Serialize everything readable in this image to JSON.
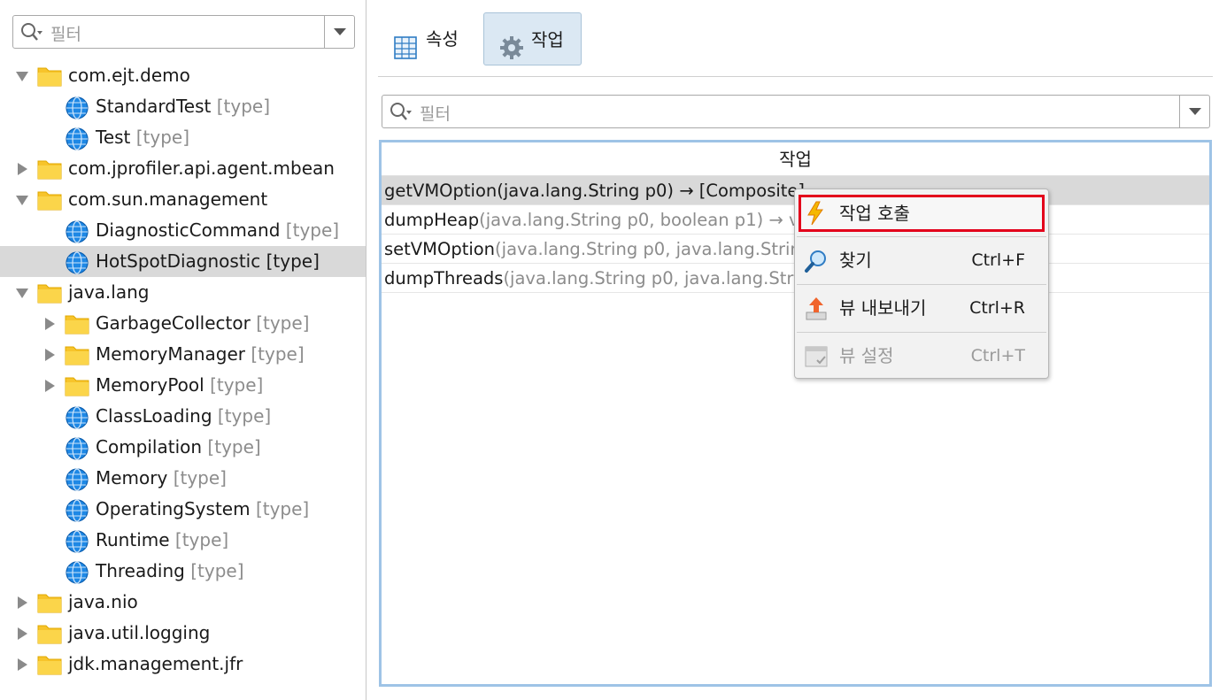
{
  "left_panel": {
    "filter_placeholder": "필터",
    "tree": [
      {
        "label": "com.ejt.demo",
        "kind": "folder",
        "level": 0,
        "arrow": "open"
      },
      {
        "label": "StandardTest",
        "suffix": "[type]",
        "kind": "globe",
        "level": 1,
        "arrow": "none"
      },
      {
        "label": "Test",
        "suffix": "[type]",
        "kind": "globe",
        "level": 1,
        "arrow": "none"
      },
      {
        "label": "com.jprofiler.api.agent.mbean",
        "kind": "folder",
        "level": 0,
        "arrow": "closed"
      },
      {
        "label": "com.sun.management",
        "kind": "folder",
        "level": 0,
        "arrow": "open"
      },
      {
        "label": "DiagnosticCommand",
        "suffix": "[type]",
        "kind": "globe",
        "level": 1,
        "arrow": "none"
      },
      {
        "label": "HotSpotDiagnostic",
        "suffix": "[type]",
        "kind": "globe",
        "level": 1,
        "arrow": "none",
        "selected": true
      },
      {
        "label": "java.lang",
        "kind": "folder",
        "level": 0,
        "arrow": "open"
      },
      {
        "label": "GarbageCollector",
        "suffix": "[type]",
        "kind": "folder",
        "level": 1,
        "arrow": "closed"
      },
      {
        "label": "MemoryManager",
        "suffix": "[type]",
        "kind": "folder",
        "level": 1,
        "arrow": "closed"
      },
      {
        "label": "MemoryPool",
        "suffix": "[type]",
        "kind": "folder",
        "level": 1,
        "arrow": "closed"
      },
      {
        "label": "ClassLoading",
        "suffix": "[type]",
        "kind": "globe",
        "level": 1,
        "arrow": "none"
      },
      {
        "label": "Compilation",
        "suffix": "[type]",
        "kind": "globe",
        "level": 1,
        "arrow": "none"
      },
      {
        "label": "Memory",
        "suffix": "[type]",
        "kind": "globe",
        "level": 1,
        "arrow": "none"
      },
      {
        "label": "OperatingSystem",
        "suffix": "[type]",
        "kind": "globe",
        "level": 1,
        "arrow": "none"
      },
      {
        "label": "Runtime",
        "suffix": "[type]",
        "kind": "globe",
        "level": 1,
        "arrow": "none"
      },
      {
        "label": "Threading",
        "suffix": "[type]",
        "kind": "globe",
        "level": 1,
        "arrow": "none"
      },
      {
        "label": "java.nio",
        "kind": "folder",
        "level": 0,
        "arrow": "closed"
      },
      {
        "label": "java.util.logging",
        "kind": "folder",
        "level": 0,
        "arrow": "closed"
      },
      {
        "label": "jdk.management.jfr",
        "kind": "folder",
        "level": 0,
        "arrow": "closed"
      }
    ]
  },
  "tabs": [
    {
      "label": "속성",
      "icon": "grid-icon",
      "active": false
    },
    {
      "label": "작업",
      "icon": "gear-icon",
      "active": true
    }
  ],
  "right_filter_placeholder": "필터",
  "operations_table": {
    "header": "작업",
    "rows": [
      {
        "method": "getVMOption",
        "signature": "(java.lang.String p0) → [Composite]",
        "selected": true
      },
      {
        "method": "dumpHeap",
        "signature": "(java.lang.String p0, boolean p1) → void"
      },
      {
        "method": "setVMOption",
        "signature": "(java.lang.String p0, java.lang.String p1) → void"
      },
      {
        "method": "dumpThreads",
        "signature": "(java.lang.String p0, java.lang.String p1) → void"
      }
    ]
  },
  "context_menu": {
    "items": [
      {
        "label": "작업 호출",
        "shortcut": "",
        "icon": "lightning-icon",
        "highlighted": true
      },
      {
        "label": "찾기",
        "shortcut": "Ctrl+F",
        "icon": "magnifier-icon"
      },
      {
        "label": "뷰 내보내기",
        "shortcut": "Ctrl+R",
        "icon": "export-icon"
      },
      {
        "label": "뷰 설정",
        "shortcut": "Ctrl+T",
        "icon": "view-settings-icon",
        "disabled": true
      }
    ]
  },
  "colors": {
    "selection": "#d9d9d9",
    "grid_border": "#9ec3e6",
    "menu_highlight_border": "#e3001b",
    "type_text": "#8c8c8c",
    "folder_yellow": "#f7c42b",
    "globe_blue": "#1e88e5"
  }
}
